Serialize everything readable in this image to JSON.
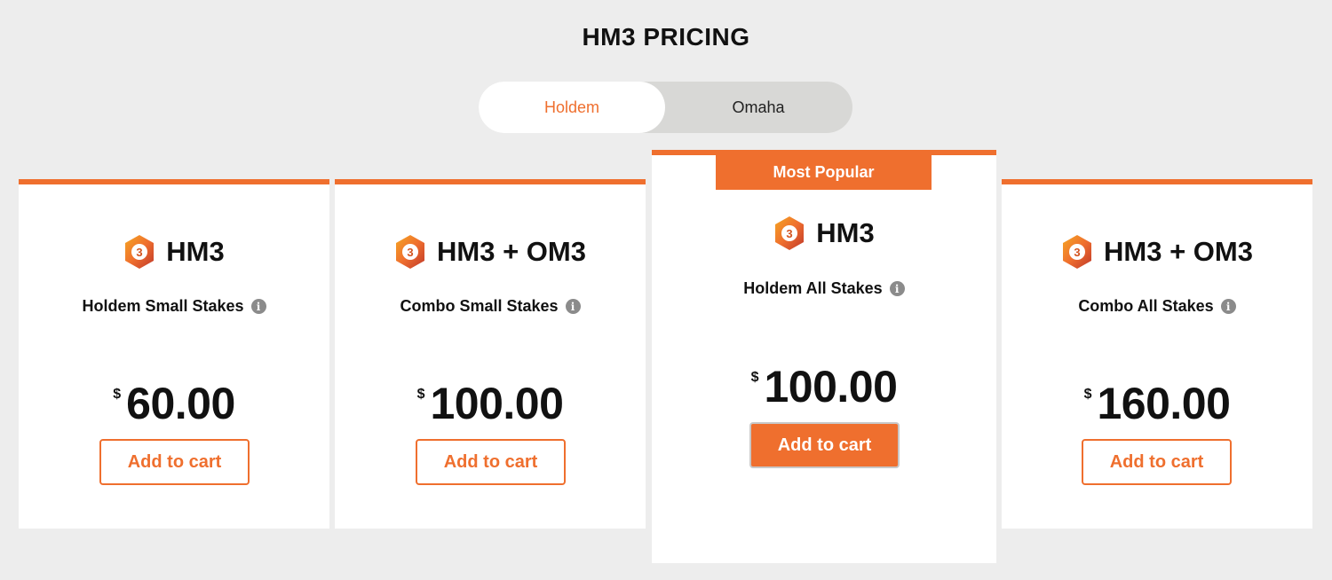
{
  "page": {
    "title": "HM3 PRICING"
  },
  "toggle": {
    "tabs": [
      {
        "label": "Holdem",
        "active": true
      },
      {
        "label": "Omaha",
        "active": false
      }
    ]
  },
  "colors": {
    "accent": "#ef6f2e",
    "background": "#ededed",
    "card": "#ffffff",
    "info_icon": "#8b8b8b"
  },
  "cards": [
    {
      "product": "HM3",
      "plan": "Holdem Small Stakes",
      "currency": "$",
      "price": "60.00",
      "button": "Add to cart",
      "featured": false
    },
    {
      "product": "HM3 + OM3",
      "plan": "Combo Small Stakes",
      "currency": "$",
      "price": "100.00",
      "button": "Add to cart",
      "featured": false
    },
    {
      "product": "HM3",
      "plan": "Holdem All Stakes",
      "currency": "$",
      "price": "100.00",
      "button": "Add to cart",
      "featured": true,
      "badge": "Most Popular"
    },
    {
      "product": "HM3 + OM3",
      "plan": "Combo All Stakes",
      "currency": "$",
      "price": "160.00",
      "button": "Add to cart",
      "featured": false
    }
  ],
  "icons": {
    "logo": "hm3-hexagon-logo-icon",
    "info": "info-icon"
  }
}
